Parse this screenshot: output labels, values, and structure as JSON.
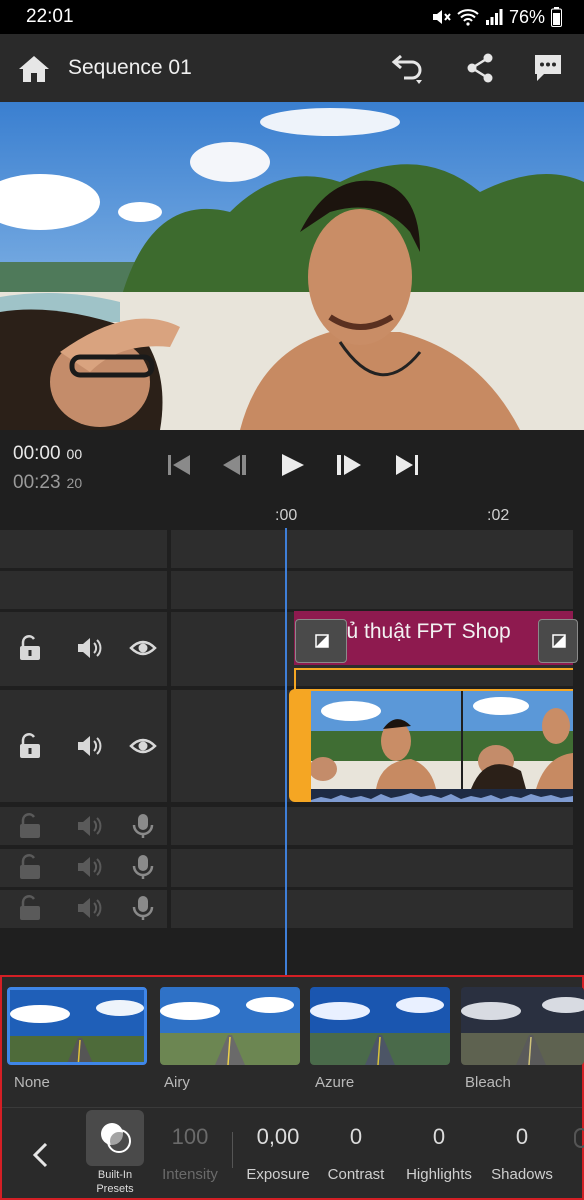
{
  "status_bar": {
    "time": "22:01",
    "battery": "76%"
  },
  "header": {
    "title": "Sequence 01"
  },
  "transport": {
    "current_time": "00:00",
    "current_frames": "00",
    "total_time": "00:23",
    "total_frames": "20"
  },
  "ruler": {
    "marks": [
      ":00",
      ":02"
    ]
  },
  "title_clip": {
    "text": "Thủ thuật FPT Shop"
  },
  "presets": [
    {
      "label": "None",
      "selected": true
    },
    {
      "label": "Airy",
      "selected": false
    },
    {
      "label": "Azure",
      "selected": false
    },
    {
      "label": "Bleach",
      "selected": false
    }
  ],
  "toolbar": {
    "builtin_label": "Built-In Presets",
    "intensity": {
      "value": "100",
      "label": "Intensity"
    },
    "exposure": {
      "value": "0,00",
      "label": "Exposure"
    },
    "contrast": {
      "value": "0",
      "label": "Contrast"
    },
    "highlights": {
      "value": "0",
      "label": "Highlights"
    },
    "shadows": {
      "value": "0",
      "label": "Shadows"
    }
  },
  "colors": {
    "accent_blue": "#3f86e8",
    "title_clip": "#8e1a4f",
    "video_clip_border": "#f5a623",
    "highlight_border": "#d41f25"
  }
}
